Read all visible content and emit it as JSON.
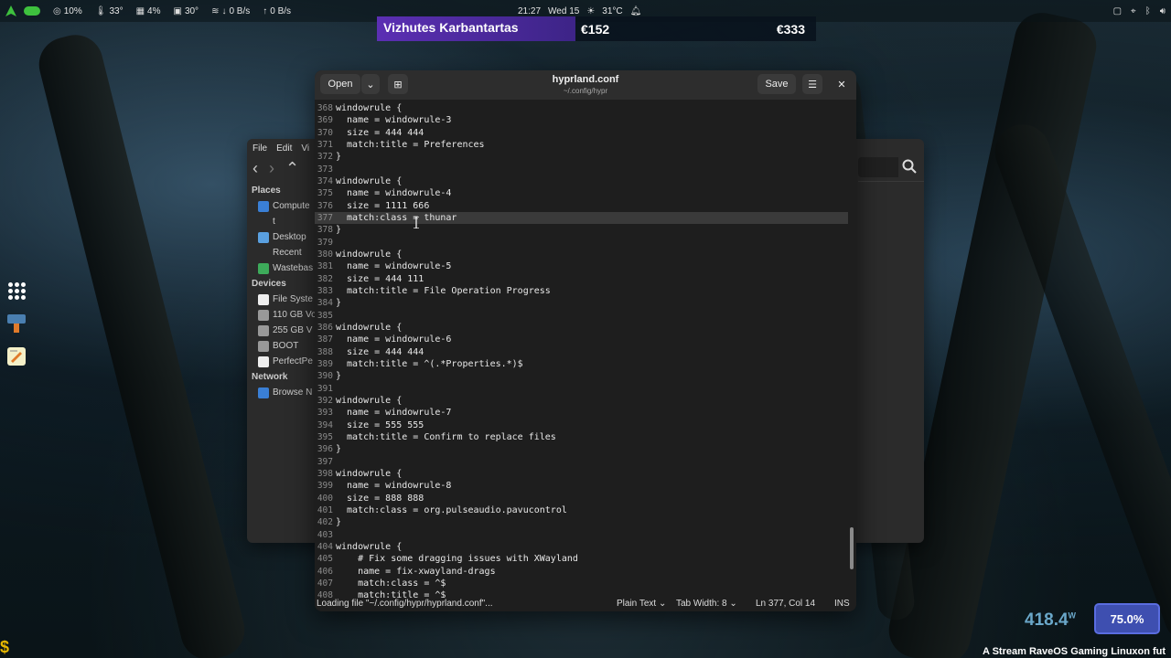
{
  "topbar": {
    "cpu": "10%",
    "temp1": "33°",
    "mem": "4%",
    "temp2": "30°",
    "net_down": "0 B/s",
    "net_up": "0 B/s",
    "time": "21:27",
    "date": "Wed 15",
    "weather": "31°C"
  },
  "banner": {
    "name": "Vizhutes Karbantartas",
    "amount1": "€152",
    "amount2": "€333"
  },
  "file_manager": {
    "menu": [
      "File",
      "Edit",
      "Vi"
    ],
    "places_heading": "Places",
    "places": [
      "Compute",
      "t",
      "Desktop",
      "Recent",
      "Wastebas"
    ],
    "devices_heading": "Devices",
    "devices": [
      "File Syste",
      "110 GB Vo",
      "255 GB V",
      "BOOT",
      "PerfectPe"
    ],
    "network_heading": "Network",
    "network": [
      "Browse N"
    ]
  },
  "editor": {
    "open_label": "Open",
    "save_label": "Save",
    "title": "hyprland.conf",
    "path": "~/.config/hypr",
    "lines": [
      {
        "n": "368",
        "t": "windowrule {"
      },
      {
        "n": "369",
        "t": "  name = windowrule-3"
      },
      {
        "n": "370",
        "t": "  size = 444 444"
      },
      {
        "n": "371",
        "t": "  match:title = Preferences"
      },
      {
        "n": "372",
        "t": "}"
      },
      {
        "n": "373",
        "t": ""
      },
      {
        "n": "374",
        "t": "windowrule {"
      },
      {
        "n": "375",
        "t": "  name = windowrule-4"
      },
      {
        "n": "376",
        "t": "  size = 1111 666"
      },
      {
        "n": "377",
        "t": "  match:class = thunar",
        "current": true
      },
      {
        "n": "378",
        "t": "}"
      },
      {
        "n": "379",
        "t": ""
      },
      {
        "n": "380",
        "t": "windowrule {"
      },
      {
        "n": "381",
        "t": "  name = windowrule-5"
      },
      {
        "n": "382",
        "t": "  size = 444 111"
      },
      {
        "n": "383",
        "t": "  match:title = File Operation Progress"
      },
      {
        "n": "384",
        "t": "}"
      },
      {
        "n": "385",
        "t": ""
      },
      {
        "n": "386",
        "t": "windowrule {"
      },
      {
        "n": "387",
        "t": "  name = windowrule-6"
      },
      {
        "n": "388",
        "t": "  size = 444 444"
      },
      {
        "n": "389",
        "t": "  match:title = ^(.*Properties.*)$"
      },
      {
        "n": "390",
        "t": "}"
      },
      {
        "n": "391",
        "t": ""
      },
      {
        "n": "392",
        "t": "windowrule {"
      },
      {
        "n": "393",
        "t": "  name = windowrule-7"
      },
      {
        "n": "394",
        "t": "  size = 555 555"
      },
      {
        "n": "395",
        "t": "  match:title = Confirm to replace files"
      },
      {
        "n": "396",
        "t": "}"
      },
      {
        "n": "397",
        "t": ""
      },
      {
        "n": "398",
        "t": "windowrule {"
      },
      {
        "n": "399",
        "t": "  name = windowrule-8"
      },
      {
        "n": "400",
        "t": "  size = 888 888"
      },
      {
        "n": "401",
        "t": "  match:class = org.pulseaudio.pavucontrol"
      },
      {
        "n": "402",
        "t": "}"
      },
      {
        "n": "403",
        "t": ""
      },
      {
        "n": "404",
        "t": "windowrule {"
      },
      {
        "n": "405",
        "t": "    # Fix some dragging issues with XWayland"
      },
      {
        "n": "406",
        "t": "    name = fix-xwayland-drags"
      },
      {
        "n": "407",
        "t": "    match:class = ^$"
      },
      {
        "n": "408",
        "t": "    match:title = ^$"
      }
    ],
    "status": {
      "loading": "Loading file \"~/.config/hypr/hyprland.conf\"...",
      "language": "Plain Text",
      "tab_width": "Tab Width: 8",
      "position": "Ln 377, Col 14",
      "mode": "INS"
    }
  },
  "widgets": {
    "power": "418.4",
    "power_unit": "W",
    "battery": "75.0%",
    "ticker": "A Stream RaveOS Gaming Linuxon fut"
  },
  "colors": {
    "toggle": "#3ec13e",
    "banner_purple": "#5b2fb3",
    "battery_blue": "#3e4fb0"
  }
}
